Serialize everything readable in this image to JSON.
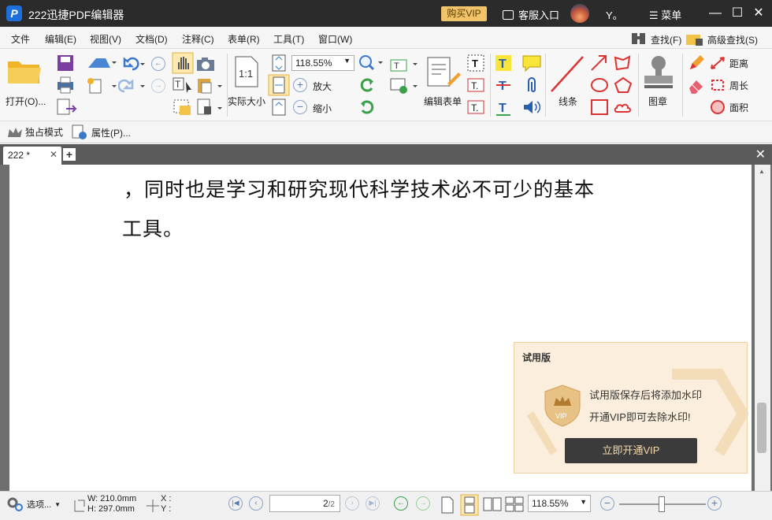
{
  "app": {
    "title": "222迅捷PDF编辑器",
    "vip": "购买VIP",
    "service": "客服入口",
    "user": "Y。",
    "menu": "菜单"
  },
  "menubar": {
    "items": [
      "文件",
      "编辑(E)",
      "视图(V)",
      "文档(D)",
      "注释(C)",
      "表单(R)",
      "工具(T)",
      "窗口(W)"
    ],
    "find": "查找(F)",
    "adv_find": "高级查找(S)"
  },
  "toolbar": {
    "open": "打开(O)...",
    "zoom_value": "118.55%",
    "actual_size": "实际大小",
    "zoom_in": "放大",
    "zoom_out": "缩小",
    "edit_form": "编辑表单",
    "lines": "线条",
    "stamp": "图章",
    "distance": "距离",
    "perimeter": "周长",
    "area": "面积"
  },
  "subbar": {
    "exclusive": "独占模式",
    "properties": "属性(P)..."
  },
  "tabs": {
    "active": "222 *"
  },
  "document": {
    "line1": "，同时也是学习和研究现代科学技术必不可少的基本",
    "line2": "工具。"
  },
  "trial": {
    "heading": "试用版",
    "badge": "VIP",
    "line1": "试用版保存后将添加水印",
    "line2": "开通VIP即可去除水印!",
    "button": "立即开通VIP"
  },
  "status": {
    "options": "选项...",
    "width": "W: 210.0mm",
    "height": "H: 297.0mm",
    "x": "X :",
    "y": "Y :",
    "page_value": "2",
    "page_total": "/2",
    "zoom": "118.55%"
  },
  "colors": {
    "titlebar": "#2b2b2b",
    "vip": "#f2c46a",
    "accent": "#1e6fd9",
    "trial_bg": "#fbeedc"
  }
}
